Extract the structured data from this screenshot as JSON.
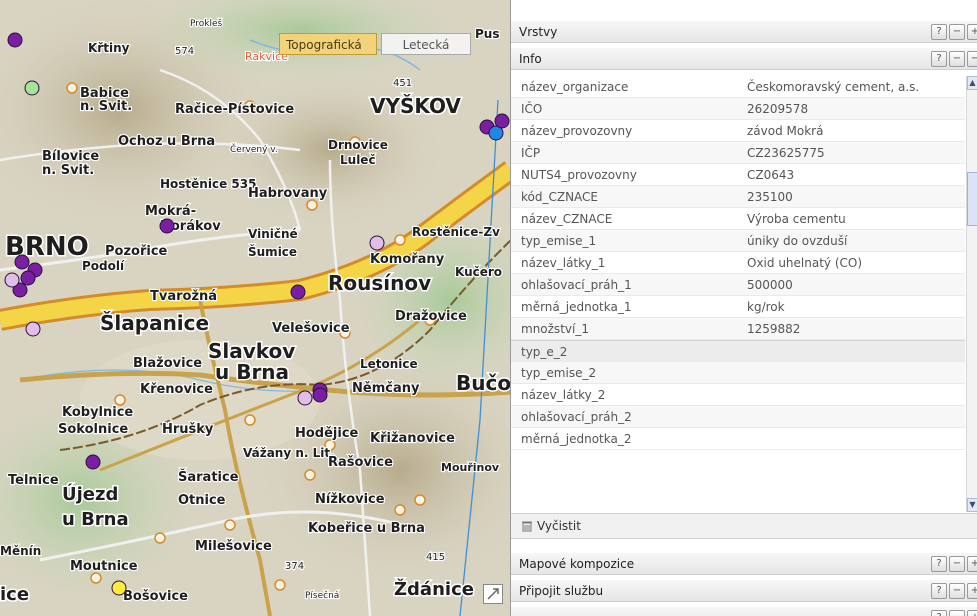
{
  "map": {
    "toggle_active": "Topografická",
    "toggle_inactive": "Letecká",
    "labels": [
      {
        "text": "Křtiny",
        "size": 12,
        "bold": true
      },
      {
        "text": "574",
        "size": 10,
        "bold": false
      },
      {
        "text": "Babice",
        "size": 13,
        "bold": true
      },
      {
        "text": "n. Svit.",
        "size": 13,
        "bold": true
      },
      {
        "text": "Račice-Pístovice",
        "size": 13,
        "bold": true
      },
      {
        "text": "VYŠKOV",
        "size": 20,
        "bold": true
      },
      {
        "text": "Ochoz u Brna",
        "size": 13,
        "bold": true
      },
      {
        "text": "Drnovice",
        "size": 12,
        "bold": true
      },
      {
        "text": "Bílovice",
        "size": 13,
        "bold": true
      },
      {
        "text": "n. Svit.",
        "size": 13,
        "bold": true
      },
      {
        "text": "Luleč",
        "size": 12,
        "bold": true
      },
      {
        "text": "Hostěnice 535",
        "size": 12,
        "bold": true
      },
      {
        "text": "Habrovany",
        "size": 13,
        "bold": true
      },
      {
        "text": "Mokrá-",
        "size": 13,
        "bold": true
      },
      {
        "text": "Horákov",
        "size": 13,
        "bold": true
      },
      {
        "text": "BRNO",
        "size": 26,
        "bold": true
      },
      {
        "text": "Pozořice",
        "size": 13,
        "bold": true
      },
      {
        "text": "Viničné",
        "size": 12,
        "bold": true
      },
      {
        "text": "Šumice",
        "size": 12,
        "bold": true
      },
      {
        "text": "Rostěnice-Zv",
        "size": 12,
        "bold": true
      },
      {
        "text": "Podolí",
        "size": 12,
        "bold": true
      },
      {
        "text": "Komořany",
        "size": 13,
        "bold": true
      },
      {
        "text": "Kučero",
        "size": 12,
        "bold": true
      },
      {
        "text": "Rousínov",
        "size": 20,
        "bold": true
      },
      {
        "text": "Tvarožná",
        "size": 13,
        "bold": true
      },
      {
        "text": "Dražovice",
        "size": 13,
        "bold": true
      },
      {
        "text": "Šlapanice",
        "size": 20,
        "bold": true
      },
      {
        "text": "Velešovice",
        "size": 13,
        "bold": true
      },
      {
        "text": "Slavkov",
        "size": 20,
        "bold": true
      },
      {
        "text": "u Brna",
        "size": 20,
        "bold": true
      },
      {
        "text": "Blažovice",
        "size": 13,
        "bold": true
      },
      {
        "text": "Letonice",
        "size": 12,
        "bold": true
      },
      {
        "text": "Bučo",
        "size": 20,
        "bold": true
      },
      {
        "text": "Křenovice",
        "size": 13,
        "bold": true
      },
      {
        "text": "Němčany",
        "size": 13,
        "bold": true
      },
      {
        "text": "Kobylnice",
        "size": 13,
        "bold": true
      },
      {
        "text": "Sokolnice",
        "size": 13,
        "bold": true
      },
      {
        "text": "Hrušky",
        "size": 13,
        "bold": true
      },
      {
        "text": "Hodějice",
        "size": 13,
        "bold": true
      },
      {
        "text": "Křižanovice",
        "size": 13,
        "bold": true
      },
      {
        "text": "Vážany n. Lit.",
        "size": 12,
        "bold": true
      },
      {
        "text": "Rašovice",
        "size": 13,
        "bold": true
      },
      {
        "text": "Mouřinov",
        "size": 11,
        "bold": true
      },
      {
        "text": "Telnice",
        "size": 13,
        "bold": true
      },
      {
        "text": "Šaratice",
        "size": 13,
        "bold": true
      },
      {
        "text": "Újezd",
        "size": 18,
        "bold": true
      },
      {
        "text": "u Brna",
        "size": 18,
        "bold": true
      },
      {
        "text": "Otnice",
        "size": 13,
        "bold": true
      },
      {
        "text": "Nížkovice",
        "size": 13,
        "bold": true
      },
      {
        "text": "Kobeřice u Brna",
        "size": 13,
        "bold": true
      },
      {
        "text": "Měnín",
        "size": 12,
        "bold": true
      },
      {
        "text": "Milešovice",
        "size": 13,
        "bold": true
      },
      {
        "text": "415",
        "size": 10,
        "bold": false
      },
      {
        "text": "Moutnice",
        "size": 13,
        "bold": true
      },
      {
        "text": "374",
        "size": 10,
        "bold": false
      },
      {
        "text": "Ždánice",
        "size": 18,
        "bold": true
      },
      {
        "text": "Bošovice",
        "size": 13,
        "bold": true
      },
      {
        "text": "451",
        "size": 10,
        "bold": false
      },
      {
        "text": "Pus",
        "size": 12,
        "bold": true
      },
      {
        "text": "ice",
        "size": 18,
        "bold": true
      },
      {
        "text": "Rakvice",
        "size": 11,
        "bold": false
      },
      {
        "text": "Prokleš",
        "size": 9,
        "bold": false
      },
      {
        "text": "Červený v.",
        "size": 9,
        "bold": false
      },
      {
        "text": "Písečná",
        "size": 9,
        "bold": false
      }
    ],
    "markers": [
      {
        "color": "#7b1fa2"
      },
      {
        "color": "#a5e39a"
      },
      {
        "color": "#7b1fa2"
      },
      {
        "color": "#1e88e5"
      },
      {
        "color": "#7b1fa2"
      },
      {
        "color": "#7b1fa2"
      },
      {
        "color": "#7b1fa2"
      },
      {
        "color": "#e1bee7"
      },
      {
        "color": "#7b1fa2"
      },
      {
        "color": "#7b1fa2"
      },
      {
        "color": "#7b1fa2"
      },
      {
        "color": "#7b1fa2"
      },
      {
        "color": "#e1bee7"
      },
      {
        "color": "#e1bee7"
      },
      {
        "color": "#7b1fa2"
      },
      {
        "color": "#7b1fa2"
      },
      {
        "color": "#7b1fa2"
      },
      {
        "color": "#ffeb3b"
      },
      {
        "color": "#e1bee7"
      }
    ]
  },
  "panel": {
    "layers_title": "Vrstvy",
    "info_title": "Info",
    "rows": [
      {
        "key": "název_organizace",
        "value": "Českomoravský cement, a.s."
      },
      {
        "key": "IČO",
        "value": "26209578"
      },
      {
        "key": "název_provozovny",
        "value": "závod Mokrá"
      },
      {
        "key": "IČP",
        "value": "CZ23625775"
      },
      {
        "key": "NUTS4_provozovny",
        "value": "CZ0643"
      },
      {
        "key": "kód_CZNACE",
        "value": "235100"
      },
      {
        "key": "název_CZNACE",
        "value": "Výroba cementu"
      },
      {
        "key": "typ_emise_1",
        "value": "úniky do ovzduší"
      },
      {
        "key": "název_látky_1",
        "value": "Oxid uhelnatý (CO)"
      },
      {
        "key": "ohlašovací_práh_1",
        "value": "500000"
      },
      {
        "key": "měrná_jednotka_1",
        "value": "kg/rok"
      },
      {
        "key": "množství_1",
        "value": "1259882"
      },
      {
        "key": "typ_e_2",
        "value": ""
      },
      {
        "key": "typ_emise_2",
        "value": ""
      },
      {
        "key": "název_látky_2",
        "value": ""
      },
      {
        "key": "ohlašovací_práh_2",
        "value": ""
      },
      {
        "key": "měrná_jednotka_2",
        "value": ""
      }
    ],
    "clear_label": "Vyčistit",
    "compositions_title": "Mapové kompozice",
    "connect_title": "Připojit službu",
    "tool_help": "?",
    "tool_minus": "−",
    "tool_plus": "+"
  }
}
